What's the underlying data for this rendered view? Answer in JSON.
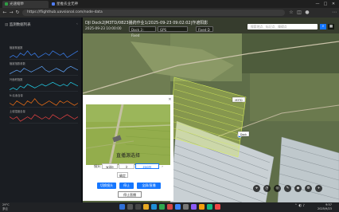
{
  "browser": {
    "tabs": [
      {
        "label": "光速缩举",
        "color": "#2f9e44"
      },
      {
        "label": "星推农业无神",
        "color": "#4f7cf3"
      }
    ],
    "url": "https://flighthub.uavsional.com/node-data",
    "window_controls": [
      "—",
      "□",
      "✕"
    ]
  },
  "sidebar": {
    "title": "监测数据列表",
    "charts": [
      {
        "label": "植被覆盖数",
        "color": "#3b82f6",
        "values": [
          5,
          6,
          5,
          7,
          6,
          8,
          6,
          7,
          5,
          6,
          7,
          6,
          8,
          7,
          6,
          7,
          5,
          6,
          7,
          8
        ]
      },
      {
        "label": "植被指数参数",
        "color": "#60a5fa",
        "values": [
          4,
          5,
          6,
          5,
          7,
          6,
          5,
          6,
          7,
          8,
          6,
          5,
          6,
          7,
          6,
          5,
          7,
          8,
          7,
          6
        ]
      },
      {
        "label": "叶面积指数",
        "color": "#22d3ee",
        "values": [
          3,
          4,
          3,
          5,
          4,
          6,
          5,
          4,
          5,
          6,
          5,
          6,
          7,
          6,
          5,
          6,
          5,
          7,
          6,
          5
        ]
      },
      {
        "label": "N-氮素含量",
        "color": "#f97316",
        "values": [
          6,
          5,
          7,
          6,
          5,
          7,
          6,
          8,
          6,
          5,
          6,
          7,
          6,
          5,
          7,
          6,
          7,
          6,
          5,
          6
        ]
      },
      {
        "label": "土壤湿度含量",
        "color": "#ef4444",
        "values": [
          8,
          7,
          8,
          6,
          7,
          8,
          7,
          9,
          8,
          7,
          8,
          7,
          9,
          8,
          7,
          8,
          9,
          8,
          7,
          8
        ]
      }
    ]
  },
  "map": {
    "title": "DJI Dock2|M3TD/0823播药作业1/2025-09-23 09:02:02|作遮阳影",
    "timestamp": "2025-09-23 10:00:00",
    "pills": [
      "Dock 3 : Fixed",
      "GPS",
      "Fixed D"
    ],
    "search_placeholder": "搜索地点、标记点、障碍点",
    "dock_label": "Dock",
    "drone_label": "M3TD"
  },
  "dialog": {
    "title": "直播源选择",
    "source_label": "镜头:",
    "source_options": [
      "wide",
      "zoom",
      "ir"
    ],
    "selected_option": "zoom",
    "confirm_label": "确定",
    "buttons": [
      "切换镜头",
      "停止",
      "全屏/直播"
    ],
    "stop_label": "停止直播"
  },
  "taskbar": {
    "weather_temp": "29°C",
    "weather_text": "多云",
    "time": "9:57",
    "date": "2025/9/23"
  },
  "colors": {
    "accent": "#1677ff",
    "sidebar_bg": "#1a1d22",
    "video_bg": "#8ea84a"
  }
}
